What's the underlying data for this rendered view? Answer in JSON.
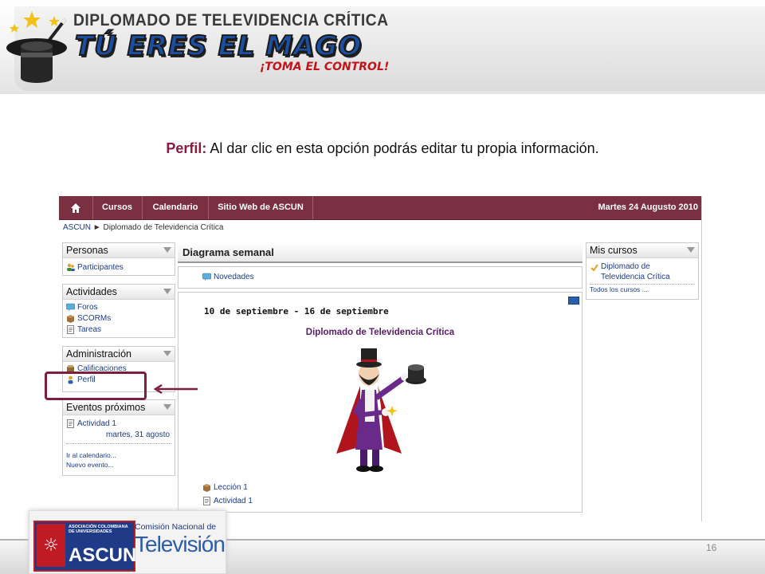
{
  "banner": {
    "top_text": "DIPLOMADO DE TELEVIDENCIA CRÍTICA",
    "main_text": "TÚ ERES EL MAGO",
    "sub_text": "¡TOMA EL CONTROL!"
  },
  "caption": {
    "keyword": "Perfil:",
    "text": " Al dar clic en esta opción podrás editar tu propia información."
  },
  "navbar": {
    "items": [
      "Cursos",
      "Calendario",
      "Sitio Web de ASCUN"
    ],
    "date": "Martes 24 Augusto 2010"
  },
  "breadcrumb": {
    "root": "ASCUN",
    "separator": "►",
    "current": "Diplomado de Televidencia Crítica"
  },
  "personas": {
    "title": "Personas",
    "items": [
      "Participantes"
    ]
  },
  "actividades": {
    "title": "Actividades",
    "items": [
      "Foros",
      "SCORMs",
      "Tareas"
    ]
  },
  "administracion": {
    "title": "Administración",
    "items": [
      "Calificaciones",
      "Perfil"
    ]
  },
  "eventos": {
    "title": "Eventos próximos",
    "event_name": "Actividad 1",
    "event_date": "martes, 31 agosto",
    "link_calendar": "Ir al calendario...",
    "link_new": "Nuevo evento..."
  },
  "center": {
    "title": "Diagrama semanal",
    "news": "Novedades",
    "week_range": "10 de septiembre - 16 de septiembre",
    "course_link": "Diplomado de Televidencia Crítica",
    "items": [
      "Lección 1",
      "Actividad 1"
    ]
  },
  "mis_cursos": {
    "title": "Mis cursos",
    "course_line1": "Diplomado de",
    "course_line2": "Televidencia Crítica",
    "all_courses": "Todos los cursos ..."
  },
  "footer": {
    "ascun_assoc": "ASOCIACIÓN COLOMBIANA DE UNIVERSIDADES",
    "ascun_name": "ASCUN",
    "cntv_top": "Comisión Nacional de",
    "cntv_main": "Televisión",
    "page_number": "16"
  },
  "colors": {
    "navbar": "#7a3040",
    "highlight": "#7a1f40",
    "link": "#1a3a8a",
    "keyword": "#8b1a3c"
  }
}
